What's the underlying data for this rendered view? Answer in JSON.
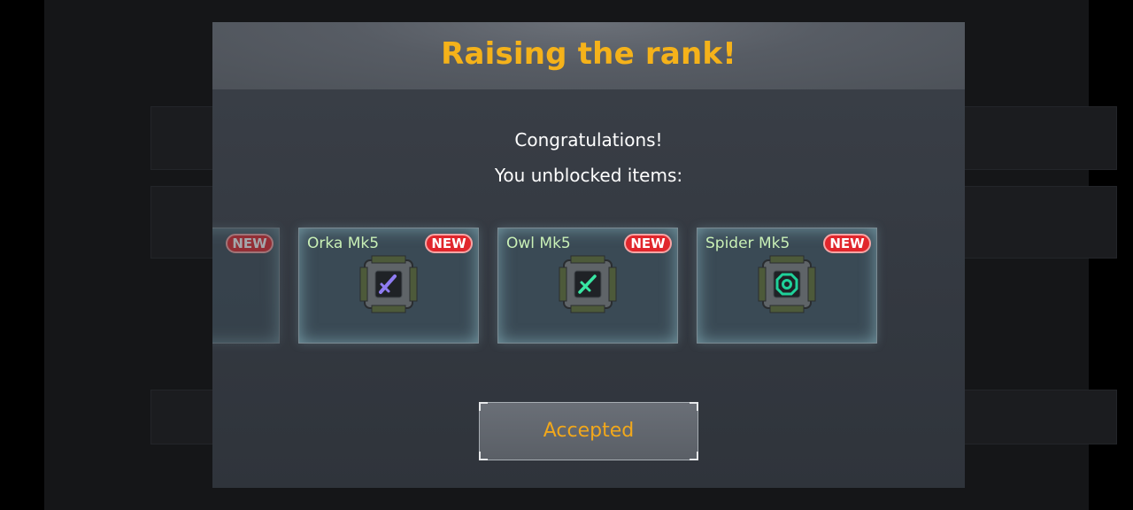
{
  "modal": {
    "title": "Raising the rank!",
    "message_line1": "Congratulations!",
    "message_line2": "You unblocked items:"
  },
  "items": [
    {
      "name": "",
      "badge": "NEW",
      "icon": "partial-item-icon"
    },
    {
      "name": "Orka Mk5",
      "badge": "NEW",
      "icon": "sword-icon",
      "icon_color": "#8f7cf2"
    },
    {
      "name": "Owl Mk5",
      "badge": "NEW",
      "icon": "sword-icon",
      "icon_color": "#38e6a3"
    },
    {
      "name": "Spider Mk5",
      "badge": "NEW",
      "icon": "octagon-ring-icon",
      "icon_color": "#1fd19a"
    }
  ],
  "button": {
    "label": "Accepted"
  },
  "colors": {
    "title": "#f5b21a",
    "item_name": "#c9f0b6",
    "badge": "#e1262c",
    "button_text": "#f2a81b"
  }
}
